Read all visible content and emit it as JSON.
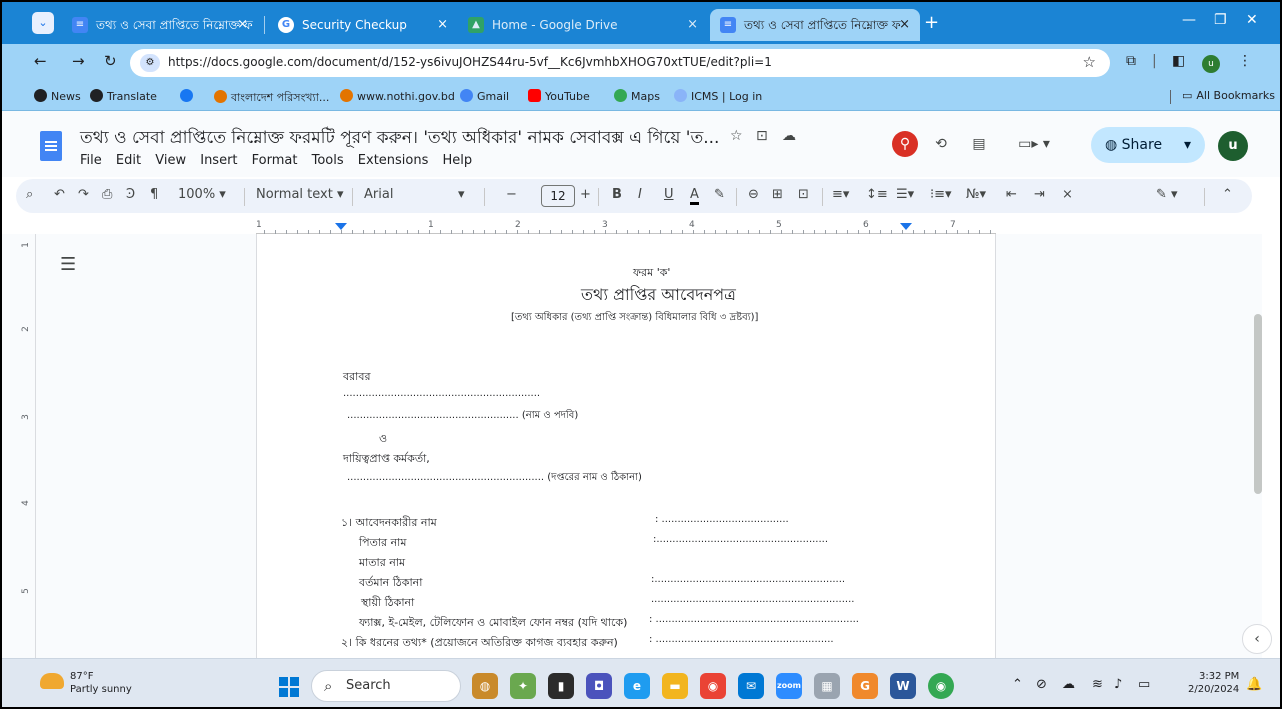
{
  "tabs": [
    {
      "title": "তথ্য ও সেবা প্রাপ্তিতে নিম্নোক্ত ফ",
      "active": false
    },
    {
      "title": "Security Checkup",
      "active": false
    },
    {
      "title": "Home - Google Drive",
      "active": false
    },
    {
      "title": "তথ্য ও সেবা প্রাপ্তিতে নিম্নোক্ত ফ",
      "active": true
    }
  ],
  "address": {
    "url": "https://docs.google.com/document/d/152-ys6ivuJOHZS44ru-5vf__Kc6JvmhbXHOG70xtTUE/edit?pli=1"
  },
  "profile_initial": "u",
  "bookmarks": [
    {
      "label": "News"
    },
    {
      "label": "Translate"
    },
    {
      "label": ""
    },
    {
      "label": "বাংলাদেশ পরিসংখ্যা..."
    },
    {
      "label": "www.nothi.gov.bd"
    },
    {
      "label": "Gmail"
    },
    {
      "label": "YouTube"
    },
    {
      "label": "Maps"
    },
    {
      "label": "ICMS | Log in"
    }
  ],
  "all_bookmarks": "All Bookmarks",
  "doc": {
    "title": "তথ্য ও সেবা প্রাপ্তিতে নিম্নোক্ত ফরমটি পূরণ করুন। 'তথ্য অধিকার' নামক সেবাবক্স এ গিয়ে 'ত...",
    "menus": [
      "File",
      "Edit",
      "View",
      "Insert",
      "Format",
      "Tools",
      "Extensions",
      "Help"
    ],
    "share_label": "Share",
    "avatar": "u"
  },
  "format_bar": {
    "zoom": "100%",
    "style": "Normal text",
    "font": "Arial",
    "font_size": "12",
    "bold": "B",
    "italic": "I",
    "underline": "U",
    "text_color": "A"
  },
  "ruler": {
    "h_numbers": [
      "1",
      "1",
      "2",
      "3",
      "4",
      "5",
      "6",
      "7"
    ],
    "v_numbers": [
      "1",
      "2",
      "3",
      "4",
      "5"
    ]
  },
  "page": {
    "form_label": "ফরম 'ক'",
    "heading": "তথ্য প্রাপ্তির আবেদনপত্র",
    "subheading": "[তথ্য অধিকার (তথ্য প্রাপ্তি সংক্রান্ত) বিধিমালার বিধি ৩ দ্রষ্টব্য)]",
    "to": "বরাবর",
    "dots1": "..............................................................",
    "name_line": "...................................................... (নাম ও পদবি)",
    "and": "ও",
    "officer": "দায়িত্বপ্রাপ্ত কর্মকর্তা,",
    "office_line": ".............................................................. (দপ্তরের নাম ও ঠিকানা)",
    "fields": [
      {
        "label": "১। আবেদনকারীর নাম",
        "value": ": ........................................"
      },
      {
        "label": "পিতার নাম",
        "value": ":......................................................"
      },
      {
        "label": "মাতার নাম",
        "value": ""
      },
      {
        "label": "বর্তমান ঠিকানা",
        "value": ":............................................................"
      },
      {
        "label": "স্থায়ী ঠিকানা",
        "value": "................................................................"
      },
      {
        "label": "ফ্যাক্স, ই-মেইল, টেলিফোন ও মোবাইল ফোন নম্বর (যদি থাকে)",
        "value": ": ................................................................"
      },
      {
        "label": "২। কি ধরনের তথ্য* (প্রয়োজনে অতিরিক্ত কাগজ ব্যবহার করুন)",
        "value": ": ........................................................"
      }
    ]
  },
  "taskbar": {
    "temp": "87°F",
    "condition": "Partly sunny",
    "search": "Search",
    "time": "3:32 PM",
    "date": "2/20/2024"
  },
  "colors": {
    "accent": "#1a73e8",
    "tabstrip": "#1b84d4",
    "toolbar": "#9ed3f7"
  }
}
